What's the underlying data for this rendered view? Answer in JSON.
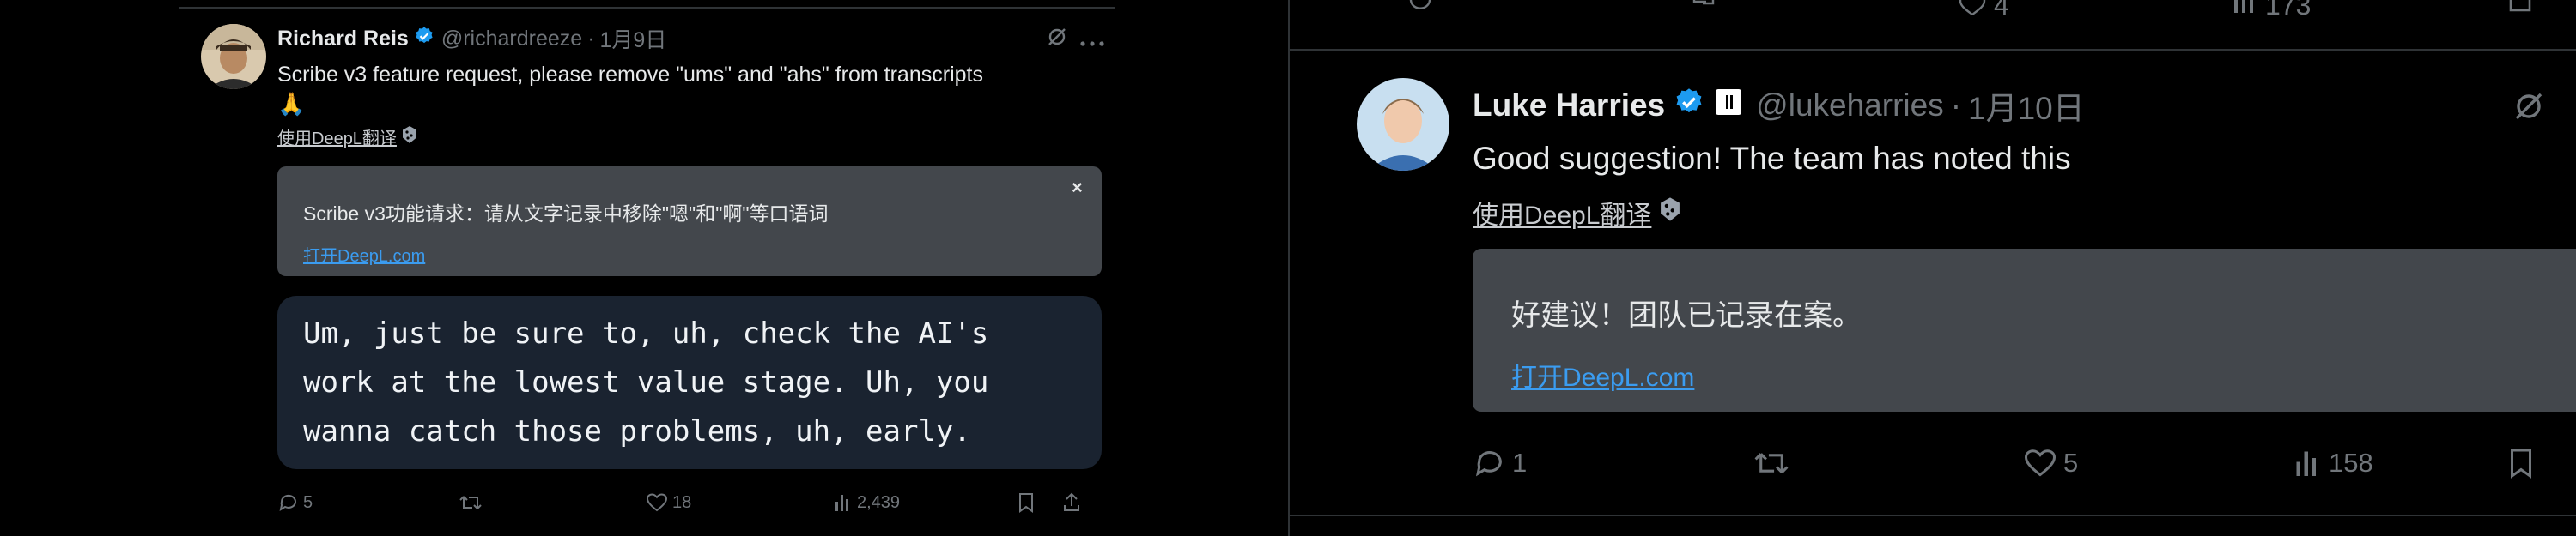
{
  "left_tweet": {
    "author_name": "Richard Reis",
    "handle": "@richardreeze",
    "date": "1月9日",
    "text_line1": "Scribe v3 feature request, please remove \"ums\" and \"ahs\" from transcripts",
    "text_emoji": "🙏",
    "translate_label": "使用DeepL翻译",
    "translation": {
      "text": "Scribe v3功能请求：请从文字记录中移除\"嗯\"和\"啊\"等口语词",
      "link": "打开DeepL.com",
      "close": "×"
    },
    "quote_lines": [
      "Um, just be sure to, uh, check the AI's",
      "work at the lowest value stage. Uh, you",
      "wanna catch those problems, uh, early."
    ],
    "actions": {
      "replies": "5",
      "retweets": "",
      "likes": "18",
      "views": "2,439"
    }
  },
  "right_top_actions": {
    "likes": "4",
    "views": "173"
  },
  "right_tweet": {
    "author_name": "Luke Harries",
    "handle": "@lukeharries",
    "date": "1月10日",
    "text": "Good suggestion! The team has noted this",
    "translate_label": "使用DeepL翻译",
    "translation": {
      "text": "好建议！团队已记录在案。",
      "link": "打开DeepL.com"
    },
    "actions": {
      "replies": "1",
      "retweets": "",
      "likes": "5",
      "views": "158"
    }
  },
  "colors": {
    "background": "#000000",
    "verified": "#1d9bf0",
    "link": "#3b9cf0",
    "translation_box": "#43474c",
    "code_box": "#1a2330",
    "muted": "#71767b"
  }
}
